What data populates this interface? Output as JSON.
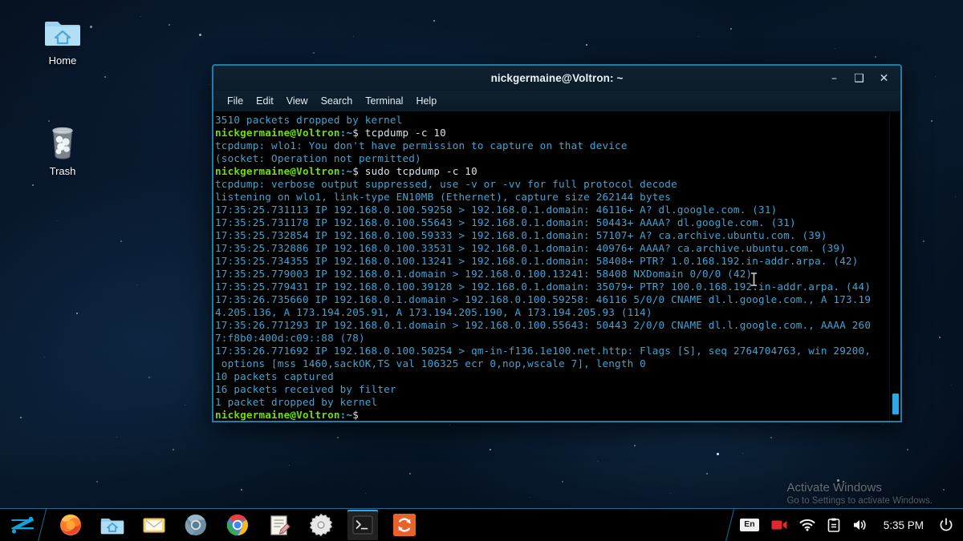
{
  "desktop": {
    "icons": [
      {
        "name": "home",
        "label": "Home",
        "icon": "folder-home-icon"
      },
      {
        "name": "trash",
        "label": "Trash",
        "icon": "trash-icon"
      }
    ]
  },
  "terminal": {
    "title": "nickgermaine@Voltron: ~",
    "window_buttons": {
      "minimize": "–",
      "maximize": "❑",
      "close": "✕"
    },
    "menu": [
      "File",
      "Edit",
      "View",
      "Search",
      "Terminal",
      "Help"
    ],
    "prompt": {
      "user_host": "nickgermaine@Voltron",
      "path": ":~",
      "sigil": "$"
    },
    "lines": [
      {
        "type": "out",
        "text": "3510 packets dropped by kernel"
      },
      {
        "type": "prompt",
        "cmd": " tcpdump -c 10"
      },
      {
        "type": "out",
        "text": "tcpdump: wlo1: You don't have permission to capture on that device"
      },
      {
        "type": "out",
        "text": "(socket: Operation not permitted)"
      },
      {
        "type": "prompt",
        "cmd": " sudo tcpdump -c 10"
      },
      {
        "type": "out",
        "text": "tcpdump: verbose output suppressed, use -v or -vv for full protocol decode"
      },
      {
        "type": "out",
        "text": "listening on wlo1, link-type EN10MB (Ethernet), capture size 262144 bytes"
      },
      {
        "type": "out",
        "text": "17:35:25.731113 IP 192.168.0.100.59258 > 192.168.0.1.domain: 46116+ A? dl.google.com. (31)"
      },
      {
        "type": "out",
        "text": "17:35:25.731178 IP 192.168.0.100.55643 > 192.168.0.1.domain: 50443+ AAAA? dl.google.com. (31)"
      },
      {
        "type": "out",
        "text": "17:35:25.732854 IP 192.168.0.100.59333 > 192.168.0.1.domain: 57107+ A? ca.archive.ubuntu.com. (39)"
      },
      {
        "type": "out",
        "text": "17:35:25.732886 IP 192.168.0.100.33531 > 192.168.0.1.domain: 40976+ AAAA? ca.archive.ubuntu.com. (39)"
      },
      {
        "type": "out",
        "text": "17:35:25.734355 IP 192.168.0.100.13241 > 192.168.0.1.domain: 58408+ PTR? 1.0.168.192.in-addr.arpa. (42)"
      },
      {
        "type": "out",
        "text": "17:35:25.779003 IP 192.168.0.1.domain > 192.168.0.100.13241: 58408 NXDomain 0/0/0 (42)"
      },
      {
        "type": "out",
        "text": "17:35:25.779431 IP 192.168.0.100.39128 > 192.168.0.1.domain: 35079+ PTR? 100.0.168.192.in-addr.arpa. (44)"
      },
      {
        "type": "out",
        "text": "17:35:26.735660 IP 192.168.0.1.domain > 192.168.0.100.59258: 46116 5/0/0 CNAME dl.l.google.com., A 173.19"
      },
      {
        "type": "out",
        "text": "4.205.136, A 173.194.205.91, A 173.194.205.190, A 173.194.205.93 (114)"
      },
      {
        "type": "out",
        "text": "17:35:26.771293 IP 192.168.0.1.domain > 192.168.0.100.55643: 50443 2/0/0 CNAME dl.l.google.com., AAAA 260"
      },
      {
        "type": "out",
        "text": "7:f8b0:400d:c09::88 (78)"
      },
      {
        "type": "out",
        "text": "17:35:26.771692 IP 192.168.0.100.50254 > qm-in-f136.1e100.net.http: Flags [S], seq 2764704763, win 29200,"
      },
      {
        "type": "out",
        "text": " options [mss 1460,sackOK,TS val 106325 ecr 0,nop,wscale 7], length 0"
      },
      {
        "type": "out",
        "text": "10 packets captured"
      },
      {
        "type": "out",
        "text": "16 packets received by filter"
      },
      {
        "type": "out",
        "text": "1 packet dropped by kernel"
      },
      {
        "type": "prompt",
        "cmd": ""
      }
    ]
  },
  "watermark": {
    "title": "Activate Windows",
    "subtitle": "Go to Settings to activate Windows."
  },
  "taskbar": {
    "start": {
      "name": "zorin-start-button",
      "tooltip": "Zorin Menu"
    },
    "launchers": [
      {
        "name": "firefox",
        "label": "Firefox",
        "icon": "firefox-icon"
      },
      {
        "name": "files",
        "label": "Files",
        "icon": "folder-home-icon"
      },
      {
        "name": "mail",
        "label": "Mail",
        "icon": "mail-icon"
      },
      {
        "name": "chromium",
        "label": "Chromium",
        "icon": "chromium-icon"
      },
      {
        "name": "chrome",
        "label": "Google Chrome",
        "icon": "chrome-icon"
      },
      {
        "name": "text-editor",
        "label": "Text Editor",
        "icon": "notepad-pencil-icon"
      },
      {
        "name": "settings",
        "label": "Settings",
        "icon": "gear-icon"
      },
      {
        "name": "terminal",
        "label": "Terminal",
        "icon": "terminal-icon",
        "active": true
      },
      {
        "name": "software-updater",
        "label": "Software Updater",
        "icon": "refresh-sync-icon"
      }
    ],
    "tray": {
      "language": "En",
      "items": [
        {
          "name": "screen-recorder",
          "icon": "record-camera-icon"
        },
        {
          "name": "network",
          "icon": "wifi-icon"
        },
        {
          "name": "clipboard",
          "icon": "clipboard-icon"
        },
        {
          "name": "volume",
          "icon": "speaker-icon"
        }
      ],
      "clock": "5:35 PM",
      "power": {
        "name": "power-button",
        "icon": "power-icon"
      }
    }
  },
  "colors": {
    "accent": "#2aa8e8",
    "terminal_bg": "#000000",
    "terminal_fg": "#3aa6d8",
    "prompt_green": "#6ee000",
    "window_border": "#1d7fa8",
    "taskbar_bg": "#000000"
  }
}
